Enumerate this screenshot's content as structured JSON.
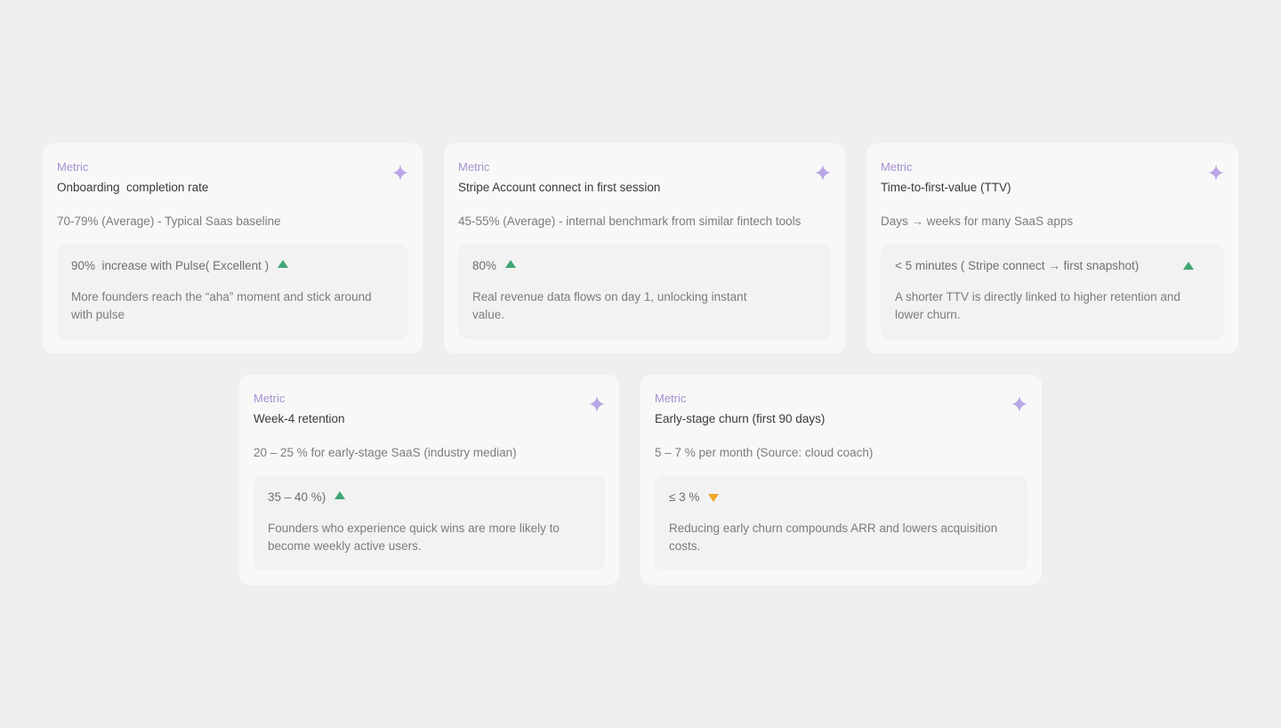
{
  "cards": [
    {
      "label": "Metric",
      "title": "Onboarding  completion rate",
      "baseline": "70-79% (Average) - Typical Saas baseline",
      "result": "90%  increase with Pulse( Excellent )",
      "trend": "up",
      "description": "More founders reach the “aha” moment and stick around with pulse"
    },
    {
      "label": "Metric",
      "title": "Stripe Account connect in first session",
      "baseline": "45-55% (Average) - internal benchmark from similar fintech tools",
      "result": "80%",
      "trend": "up",
      "description": "Real revenue data flows on day 1, unlocking instant value."
    },
    {
      "label": "Metric",
      "title": "Time-to-first-value (TTV)",
      "baseline": "Days → weeks for many SaaS apps",
      "result": "< 5 minutes ( Stripe connect → first snapshot)",
      "trend": "up",
      "description": "A shorter TTV is directly linked to higher retention and lower churn."
    },
    {
      "label": "Metric",
      "title": "Week-4 retention",
      "baseline": "20 – 25 % for early-stage SaaS (industry median)",
      "result": "35 – 40 %)",
      "trend": "up",
      "description": "Founders who experience quick wins are more likely to become weekly active users."
    },
    {
      "label": "Metric",
      "title": "Early-stage churn (first 90 days)",
      "baseline": "5 – 7 % per month (Source: cloud coach)",
      "result": "≤ 3 %",
      "trend": "down",
      "description": "Reducing early churn compounds ARR and lowers acquisition costs."
    }
  ],
  "colors": {
    "background": "#efefef",
    "card": "#f8f8f8",
    "inner": "#f2f2f2",
    "accent": "#a690cf",
    "sparkle": "#b9a6e6",
    "trend_up": "#3fa674",
    "trend_down": "#f0a52a"
  },
  "icons": {
    "sparkle": "sparkle-icon",
    "trend_up": "triangle-up-icon",
    "trend_down": "triangle-down-icon"
  }
}
